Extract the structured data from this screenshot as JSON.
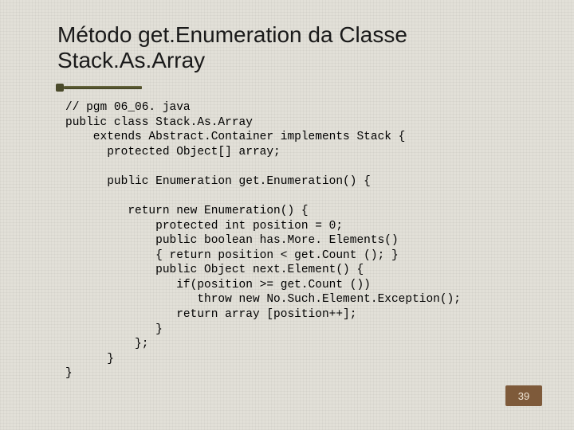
{
  "title": "Método get.Enumeration da Classe Stack.As.Array",
  "code_lines": [
    "// pgm 06_06. java",
    "public class Stack.As.Array",
    "    extends Abstract.Container implements Stack {",
    "      protected Object[] array;",
    "",
    "      public Enumeration get.Enumeration() {",
    "",
    "         return new Enumeration() {",
    "             protected int position = 0;",
    "             public boolean has.More. Elements()",
    "             { return position < get.Count (); }",
    "             public Object next.Element() {",
    "                if(position >= get.Count ())",
    "                   throw new No.Such.Element.Exception();",
    "                return array [position++];",
    "             }",
    "          };",
    "      }",
    "}"
  ],
  "page_number": "39"
}
